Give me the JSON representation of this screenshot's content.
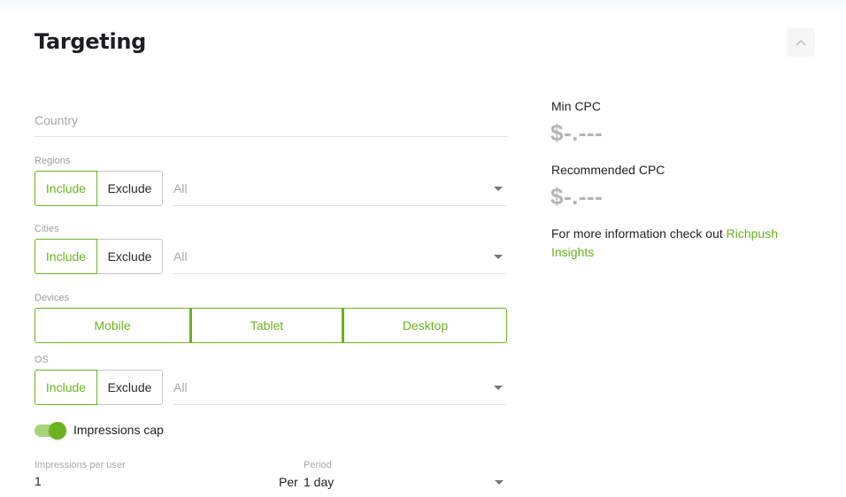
{
  "header": {
    "title": "Targeting",
    "collapse_icon": "chevron-up-icon"
  },
  "country": {
    "placeholder": "Country"
  },
  "regions": {
    "label": "Regions",
    "include_label": "Include",
    "exclude_label": "Exclude",
    "mode": "Include",
    "value": "All"
  },
  "cities": {
    "label": "Cities",
    "include_label": "Include",
    "exclude_label": "Exclude",
    "mode": "Include",
    "value": "All"
  },
  "devices": {
    "label": "Devices",
    "options": [
      "Mobile",
      "Tablet",
      "Desktop"
    ]
  },
  "os": {
    "label": "OS",
    "include_label": "Include",
    "exclude_label": "Exclude",
    "mode": "Include",
    "value": "All"
  },
  "impressions_cap": {
    "label": "Impressions cap",
    "enabled": true,
    "per_user_label": "Impressions per user",
    "per_user_value": "1",
    "period_label": "Period",
    "period_prefix": "Per",
    "period_value": "1 day"
  },
  "sidebar": {
    "min_cpc_label": "Min CPC",
    "min_cpc_value": "$-.---",
    "recommended_cpc_label": "Recommended CPC",
    "recommended_cpc_value": "$-.---",
    "info_text": "For more information check out ",
    "info_link": "Richpush Insights"
  },
  "colors": {
    "accent": "#6bb21f",
    "accent_light": "#a9d57a",
    "muted_text": "#a9a7ad",
    "price_placeholder": "#b5b3b8"
  }
}
